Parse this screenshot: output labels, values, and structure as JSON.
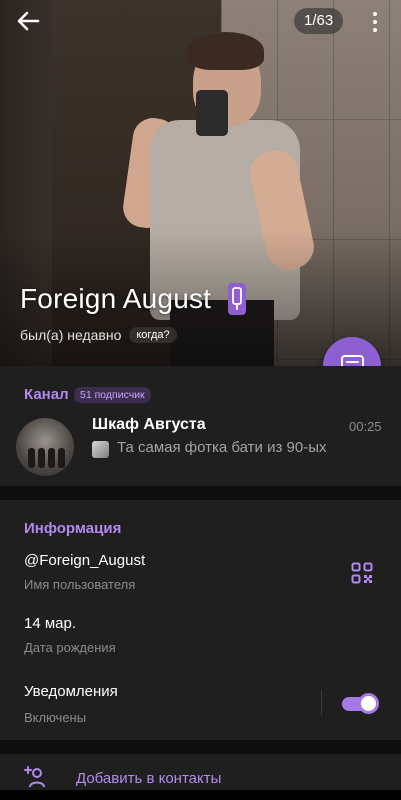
{
  "header": {
    "counter": "1/63",
    "name": "Foreign August",
    "status": "был(а) недавно",
    "when_button": "когда?"
  },
  "channel": {
    "section_title": "Канал",
    "subscribers": "51 подписчик",
    "title": "Шкаф Августа",
    "time": "00:25",
    "preview": "Та самая фотка бати из 90-ых"
  },
  "info": {
    "section_title": "Информация",
    "username": "@Foreign_August",
    "username_label": "Имя пользователя",
    "birthday": "14 мар.",
    "birthday_label": "Дата рождения",
    "notifications": "Уведомления",
    "notifications_state": "Включены",
    "notifications_on": true
  },
  "actions": {
    "add_contact": "Добавить в контакты"
  },
  "colors": {
    "accent": "#b389f0",
    "fab": "#8e5fd1",
    "card": "#1f1f1f",
    "background": "#0e0e0e"
  },
  "icons": [
    "back-arrow-icon",
    "more-vertical-icon",
    "premium-badge-icon",
    "message-icon",
    "qr-code-icon",
    "add-contact-icon"
  ]
}
